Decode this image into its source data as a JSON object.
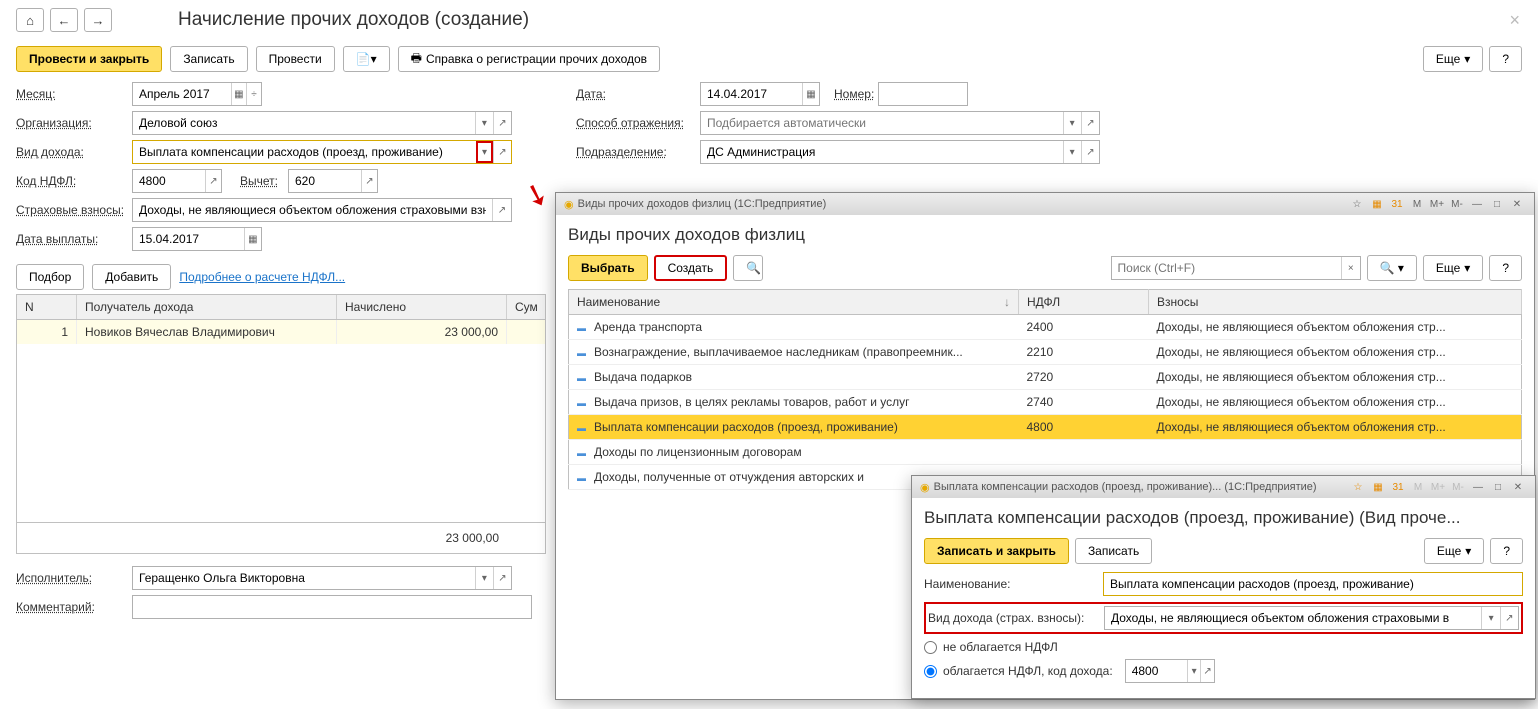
{
  "main": {
    "title": "Начисление прочих доходов (создание)",
    "toolbar": {
      "post_close": "Провести и закрыть",
      "write": "Записать",
      "post": "Провести",
      "cert": "Справка о регистрации прочих доходов",
      "more": "Еще",
      "help": "?"
    },
    "fields": {
      "month_label": "Месяц:",
      "month_value": "Апрель 2017",
      "date_label": "Дата:",
      "date_value": "14.04.2017",
      "number_label": "Номер:",
      "number_value": "",
      "org_label": "Организация:",
      "org_value": "Деловой союз",
      "reflect_label": "Способ отражения:",
      "reflect_placeholder": "Подбирается автоматически",
      "income_type_label": "Вид дохода:",
      "income_type_value": "Выплата компенсации расходов (проезд, проживание)",
      "department_label": "Подразделение:",
      "department_value": "ДС Администрация",
      "ndfl_code_label": "Код НДФЛ:",
      "ndfl_code_value": "4800",
      "deduction_label": "Вычет:",
      "deduction_value": "620",
      "insurance_label": "Страховые взносы:",
      "insurance_value": "Доходы, не являющиеся объектом обложения страховыми взн",
      "pay_date_label": "Дата выплаты:",
      "pay_date_value": "15.04.2017",
      "executor_label": "Исполнитель:",
      "executor_value": "Геращенко Ольга Викторовна",
      "comment_label": "Комментарий:"
    },
    "actions": {
      "pick": "Подбор",
      "add": "Добавить",
      "link": "Подробнее о расчете НДФЛ..."
    },
    "table": {
      "col_n": "N",
      "col_recipient": "Получатель дохода",
      "col_accrued": "Начислено",
      "col_sum": "Сум",
      "row_n": "1",
      "row_recipient": "Новиков Вячеслав Владимирович",
      "row_accrued": "23 000,00",
      "total": "23 000,00"
    }
  },
  "dlg1": {
    "sys_title": "Виды прочих доходов физлиц  (1С:Предприятие)",
    "heading": "Виды прочих доходов физлиц",
    "select": "Выбрать",
    "create": "Создать",
    "search_placeholder": "Поиск (Ctrl+F)",
    "more": "Еще",
    "help": "?",
    "cols": {
      "name": "Наименование",
      "ndfl": "НДФЛ",
      "dues": "Взносы"
    },
    "rows": [
      {
        "name": "Аренда транспорта",
        "ndfl": "2400",
        "dues": "Доходы, не являющиеся объектом обложения стр..."
      },
      {
        "name": "Вознаграждение, выплачиваемое наследникам (правопреемник...",
        "ndfl": "2210",
        "dues": "Доходы, не являющиеся объектом обложения стр..."
      },
      {
        "name": "Выдача подарков",
        "ndfl": "2720",
        "dues": "Доходы, не являющиеся объектом обложения стр..."
      },
      {
        "name": "Выдача призов, в целях рекламы товаров, работ и услуг",
        "ndfl": "2740",
        "dues": "Доходы, не являющиеся объектом обложения стр..."
      },
      {
        "name": "Выплата компенсации расходов (проезд, проживание)",
        "ndfl": "4800",
        "dues": "Доходы, не являющиеся объектом обложения стр..."
      },
      {
        "name": "Доходы по лицензионным договорам",
        "ndfl": "",
        "dues": ""
      },
      {
        "name": "Доходы, полученные от отчуждения авторских и",
        "ndfl": "",
        "dues": ""
      }
    ]
  },
  "dlg2": {
    "sys_title": "Выплата компенсации расходов (проезд, проживание)...  (1С:Предприятие)",
    "heading": "Выплата компенсации расходов (проезд, проживание) (Вид проче...",
    "write_close": "Записать и закрыть",
    "write": "Записать",
    "more": "Еще",
    "help": "?",
    "name_label": "Наименование:",
    "name_value": "Выплата компенсации расходов (проезд, проживание)",
    "ins_label": "Вид дохода (страх. взносы):",
    "ins_value": "Доходы, не являющиеся объектом обложения страховыми в",
    "radio_no_ndfl": "не облагается НДФЛ",
    "radio_ndfl": "облагается НДФЛ, код дохода:",
    "code_value": "4800"
  }
}
